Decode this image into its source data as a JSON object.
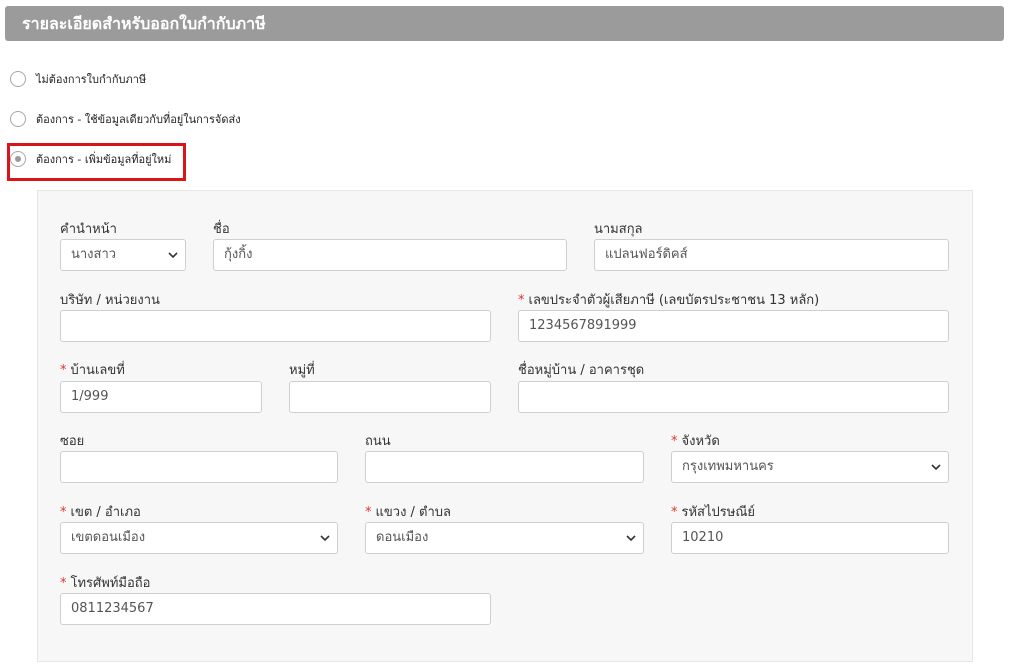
{
  "section": {
    "title": "รายละเอียดสำหรับออกใบกำกับภาษี"
  },
  "tax_invoice_options": [
    {
      "label": "ไม่ต้องการใบกำกับภาษี",
      "selected": false
    },
    {
      "label": "ต้องการ - ใช้ข้อมูลเดียวกับที่อยู่ในการจัดส่ง",
      "selected": false
    },
    {
      "label": "ต้องการ - เพิ่มข้อมูลที่อยู่ใหม่",
      "selected": true
    }
  ],
  "form": {
    "title_prefix": {
      "label": "คำนำหน้า",
      "value": "นางสาว"
    },
    "first_name": {
      "label": "ชื่อ",
      "value": "กุ้งกิ้ง"
    },
    "last_name": {
      "label": "นามสกุล",
      "value": "แปลนฟอร์ดิคส์"
    },
    "company": {
      "label": "บริษัท / หน่วยงาน",
      "value": ""
    },
    "tax_id": {
      "label": "เลขประจำตัวผู้เสียภาษี (เลขบัตรประชาชน 13 หลัก)",
      "value": "1234567891999",
      "required_mark": "*"
    },
    "house_no": {
      "label": "บ้านเลขที่",
      "value": "1/999",
      "required_mark": "*"
    },
    "moo": {
      "label": "หมู่ที่",
      "value": ""
    },
    "village": {
      "label": "ชื่อหมู่บ้าน / อาคารชุด",
      "value": ""
    },
    "soi": {
      "label": "ซอย",
      "value": ""
    },
    "road": {
      "label": "ถนน",
      "value": ""
    },
    "province": {
      "label": "จังหวัด",
      "value": "กรุงเทพมหานคร",
      "required_mark": "*"
    },
    "district": {
      "label": "เขต / อำเภอ",
      "value": "เขตดอนเมือง",
      "required_mark": "*"
    },
    "subdistrict": {
      "label": "แขวง / ตำบล",
      "value": "ดอนเมือง",
      "required_mark": "*"
    },
    "postcode": {
      "label": "รหัสไปรษณีย์",
      "value": "10210",
      "required_mark": "*"
    },
    "mobile": {
      "label": "โทรศัพท์มือถือ",
      "value": "0811234567",
      "required_mark": "*"
    }
  },
  "icons": {
    "select_arrow": "chevron-down-icon"
  },
  "colors": {
    "header_bg": "#9b9b9b",
    "highlight": "#d9141b",
    "required": "#e3342f",
    "panel_bg": "#f7f7f7"
  }
}
